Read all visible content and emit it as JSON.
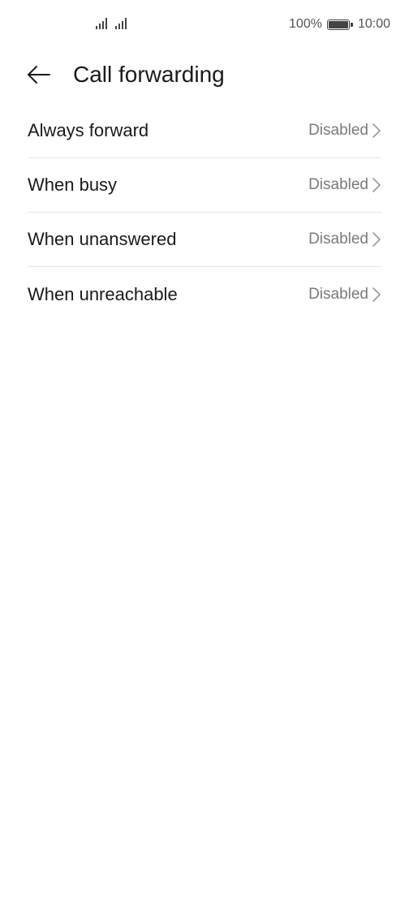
{
  "status_bar": {
    "battery_percent": "100%",
    "battery_level": 1.0,
    "time": "10:00",
    "icons": [
      "signal-icon",
      "signal-icon",
      "battery-icon"
    ]
  },
  "header": {
    "title": "Call forwarding",
    "back_icon": "back-arrow-icon"
  },
  "settings": {
    "items": [
      {
        "label": "Always forward",
        "value": "Disabled"
      },
      {
        "label": "When busy",
        "value": "Disabled"
      },
      {
        "label": "When unanswered",
        "value": "Disabled"
      },
      {
        "label": "When unreachable",
        "value": "Disabled"
      }
    ],
    "chevron_icon": "chevron-right-icon"
  },
  "colors": {
    "background": "#ffffff",
    "text_primary": "#1a1a1a",
    "text_secondary": "#7a7a7a",
    "divider": "#e6e6e6"
  }
}
